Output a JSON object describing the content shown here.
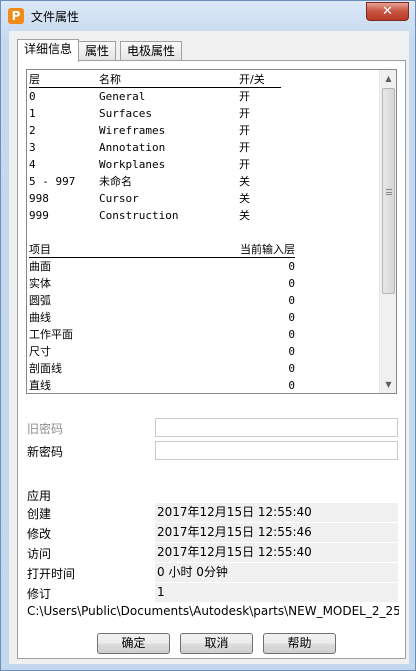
{
  "window": {
    "title": "文件属性",
    "close_glyph": "✕"
  },
  "tabs": [
    {
      "label": "详细信息",
      "active": true
    },
    {
      "label": "属性",
      "active": false
    },
    {
      "label": "电极属性",
      "active": false
    }
  ],
  "layers": {
    "headers": {
      "layer": "层",
      "name": "名称",
      "onoff": "开/关"
    },
    "rows": [
      {
        "layer": "0",
        "name": "General",
        "state": "开"
      },
      {
        "layer": "1",
        "name": "Surfaces",
        "state": "开"
      },
      {
        "layer": "2",
        "name": "Wireframes",
        "state": "开"
      },
      {
        "layer": "3",
        "name": "Annotation",
        "state": "开"
      },
      {
        "layer": "4",
        "name": "Workplanes",
        "state": "开"
      },
      {
        "layer": "5 - 997",
        "name": "未命名",
        "state": "关"
      },
      {
        "layer": "998",
        "name": "Cursor",
        "state": "关"
      },
      {
        "layer": "999",
        "name": "Construction",
        "state": "关"
      }
    ]
  },
  "items": {
    "headers": {
      "item": "项目",
      "layer": "当前输入层"
    },
    "rows": [
      {
        "item": "曲面",
        "layer": "0"
      },
      {
        "item": "实体",
        "layer": "0"
      },
      {
        "item": "圆弧",
        "layer": "0"
      },
      {
        "item": "曲线",
        "layer": "0"
      },
      {
        "item": "工作平面",
        "layer": "0"
      },
      {
        "item": "尺寸",
        "layer": "0"
      },
      {
        "item": "剖面线",
        "layer": "0"
      },
      {
        "item": "直线",
        "layer": "0"
      }
    ]
  },
  "password": {
    "old_label": "旧密码",
    "new_label": "新密码",
    "old_value": "",
    "new_value": ""
  },
  "info": {
    "app_label": "应用",
    "created_label": "创建",
    "created_value": "2017年12月15日 12:55:40",
    "modified_label": "修改",
    "modified_value": "2017年12月15日 12:55:46",
    "accessed_label": "访问",
    "accessed_value": "2017年12月15日 12:55:40",
    "open_time_label": "打开时间",
    "open_time_value": "0 小时 0分钟",
    "revision_label": "修订",
    "revision_value": "1",
    "path": "C:\\Users\\Public\\Documents\\Autodesk\\parts\\NEW_MODEL_2_25"
  },
  "buttons": {
    "ok": "确定",
    "cancel": "取消",
    "help": "帮助"
  },
  "colors": {
    "close_button": "#c7533f",
    "app_icon": "#f08a18"
  }
}
